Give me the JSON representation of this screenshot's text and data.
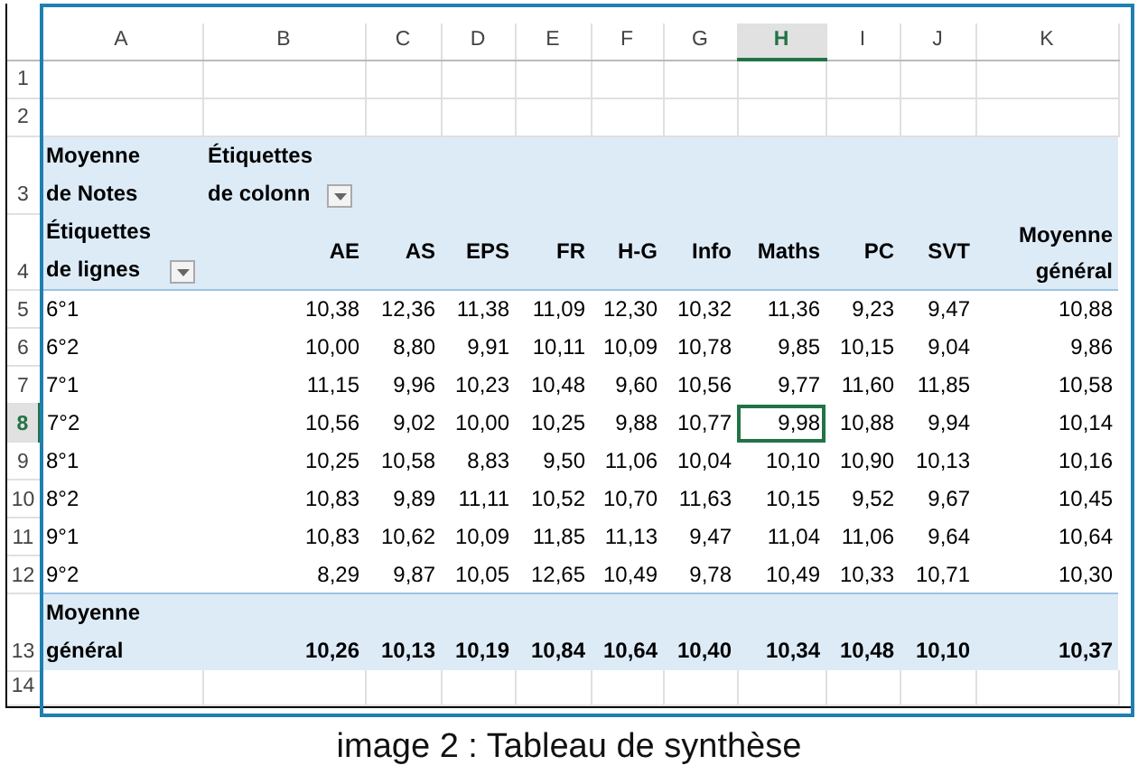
{
  "column_headers": [
    {
      "label": "A",
      "selected": false
    },
    {
      "label": "B",
      "selected": false
    },
    {
      "label": "C",
      "selected": false
    },
    {
      "label": "D",
      "selected": false
    },
    {
      "label": "E",
      "selected": false
    },
    {
      "label": "F",
      "selected": false
    },
    {
      "label": "G",
      "selected": false
    },
    {
      "label": "H",
      "selected": true
    },
    {
      "label": "I",
      "selected": false
    },
    {
      "label": "J",
      "selected": false
    },
    {
      "label": "K",
      "selected": false
    }
  ],
  "row_headers": [
    {
      "label": "1",
      "selected": false
    },
    {
      "label": "2",
      "selected": false
    },
    {
      "label": "3",
      "selected": false
    },
    {
      "label": "4",
      "selected": false
    },
    {
      "label": "5",
      "selected": false
    },
    {
      "label": "6",
      "selected": false
    },
    {
      "label": "7",
      "selected": false
    },
    {
      "label": "8",
      "selected": true
    },
    {
      "label": "9",
      "selected": false
    },
    {
      "label": "10",
      "selected": false
    },
    {
      "label": "11",
      "selected": false
    },
    {
      "label": "12",
      "selected": false
    },
    {
      "label": "13",
      "selected": false
    },
    {
      "label": "14",
      "selected": false
    }
  ],
  "pivot": {
    "value_field": "Moyenne de Notes",
    "column_caption": "Étiquettes de colonn",
    "row_caption": "Étiquettes de lignes",
    "columns": [
      "AE",
      "AS",
      "EPS",
      "FR",
      "H-G",
      "Info",
      "Maths",
      "PC",
      "SVT",
      "Moyenne général"
    ],
    "rows": [
      {
        "label": "6°1",
        "cells": [
          {
            "text": "10,38",
            "selected": false
          },
          {
            "text": "12,36",
            "selected": false
          },
          {
            "text": "11,38",
            "selected": false
          },
          {
            "text": "11,09",
            "selected": false
          },
          {
            "text": "12,30",
            "selected": false
          },
          {
            "text": "10,32",
            "selected": false
          },
          {
            "text": "11,36",
            "selected": false
          },
          {
            "text": "9,23",
            "selected": false
          },
          {
            "text": "9,47",
            "selected": false
          },
          {
            "text": "10,88",
            "selected": false
          }
        ]
      },
      {
        "label": "6°2",
        "cells": [
          {
            "text": "10,00",
            "selected": false
          },
          {
            "text": "8,80",
            "selected": false
          },
          {
            "text": "9,91",
            "selected": false
          },
          {
            "text": "10,11",
            "selected": false
          },
          {
            "text": "10,09",
            "selected": false
          },
          {
            "text": "10,78",
            "selected": false
          },
          {
            "text": "9,85",
            "selected": false
          },
          {
            "text": "10,15",
            "selected": false
          },
          {
            "text": "9,04",
            "selected": false
          },
          {
            "text": "9,86",
            "selected": false
          }
        ]
      },
      {
        "label": "7°1",
        "cells": [
          {
            "text": "11,15",
            "selected": false
          },
          {
            "text": "9,96",
            "selected": false
          },
          {
            "text": "10,23",
            "selected": false
          },
          {
            "text": "10,48",
            "selected": false
          },
          {
            "text": "9,60",
            "selected": false
          },
          {
            "text": "10,56",
            "selected": false
          },
          {
            "text": "9,77",
            "selected": false
          },
          {
            "text": "11,60",
            "selected": false
          },
          {
            "text": "11,85",
            "selected": false
          },
          {
            "text": "10,58",
            "selected": false
          }
        ]
      },
      {
        "label": "7°2",
        "cells": [
          {
            "text": "10,56",
            "selected": false
          },
          {
            "text": "9,02",
            "selected": false
          },
          {
            "text": "10,00",
            "selected": false
          },
          {
            "text": "10,25",
            "selected": false
          },
          {
            "text": "9,88",
            "selected": false
          },
          {
            "text": "10,77",
            "selected": false
          },
          {
            "text": "9,98",
            "selected": true
          },
          {
            "text": "10,88",
            "selected": false
          },
          {
            "text": "9,94",
            "selected": false
          },
          {
            "text": "10,14",
            "selected": false
          }
        ]
      },
      {
        "label": "8°1",
        "cells": [
          {
            "text": "10,25",
            "selected": false
          },
          {
            "text": "10,58",
            "selected": false
          },
          {
            "text": "8,83",
            "selected": false
          },
          {
            "text": "9,50",
            "selected": false
          },
          {
            "text": "11,06",
            "selected": false
          },
          {
            "text": "10,04",
            "selected": false
          },
          {
            "text": "10,10",
            "selected": false
          },
          {
            "text": "10,90",
            "selected": false
          },
          {
            "text": "10,13",
            "selected": false
          },
          {
            "text": "10,16",
            "selected": false
          }
        ]
      },
      {
        "label": "8°2",
        "cells": [
          {
            "text": "10,83",
            "selected": false
          },
          {
            "text": "9,89",
            "selected": false
          },
          {
            "text": "11,11",
            "selected": false
          },
          {
            "text": "10,52",
            "selected": false
          },
          {
            "text": "10,70",
            "selected": false
          },
          {
            "text": "11,63",
            "selected": false
          },
          {
            "text": "10,15",
            "selected": false
          },
          {
            "text": "9,52",
            "selected": false
          },
          {
            "text": "9,67",
            "selected": false
          },
          {
            "text": "10,45",
            "selected": false
          }
        ]
      },
      {
        "label": "9°1",
        "cells": [
          {
            "text": "10,83",
            "selected": false
          },
          {
            "text": "10,62",
            "selected": false
          },
          {
            "text": "10,09",
            "selected": false
          },
          {
            "text": "11,85",
            "selected": false
          },
          {
            "text": "11,13",
            "selected": false
          },
          {
            "text": "9,47",
            "selected": false
          },
          {
            "text": "11,04",
            "selected": false
          },
          {
            "text": "11,06",
            "selected": false
          },
          {
            "text": "9,64",
            "selected": false
          },
          {
            "text": "10,64",
            "selected": false
          }
        ]
      },
      {
        "label": "9°2",
        "cells": [
          {
            "text": "8,29",
            "selected": false
          },
          {
            "text": "9,87",
            "selected": false
          },
          {
            "text": "10,05",
            "selected": false
          },
          {
            "text": "12,65",
            "selected": false
          },
          {
            "text": "10,49",
            "selected": false
          },
          {
            "text": "9,78",
            "selected": false
          },
          {
            "text": "10,49",
            "selected": false
          },
          {
            "text": "10,33",
            "selected": false
          },
          {
            "text": "10,71",
            "selected": false
          },
          {
            "text": "10,30",
            "selected": false
          }
        ]
      }
    ],
    "total": {
      "label": "Moyenne général",
      "values": [
        "10,26",
        "10,13",
        "10,19",
        "10,84",
        "10,64",
        "10,40",
        "10,34",
        "10,48",
        "10,10",
        "10,37"
      ]
    }
  },
  "caption": "image 2 : Tableau de synthèse"
}
